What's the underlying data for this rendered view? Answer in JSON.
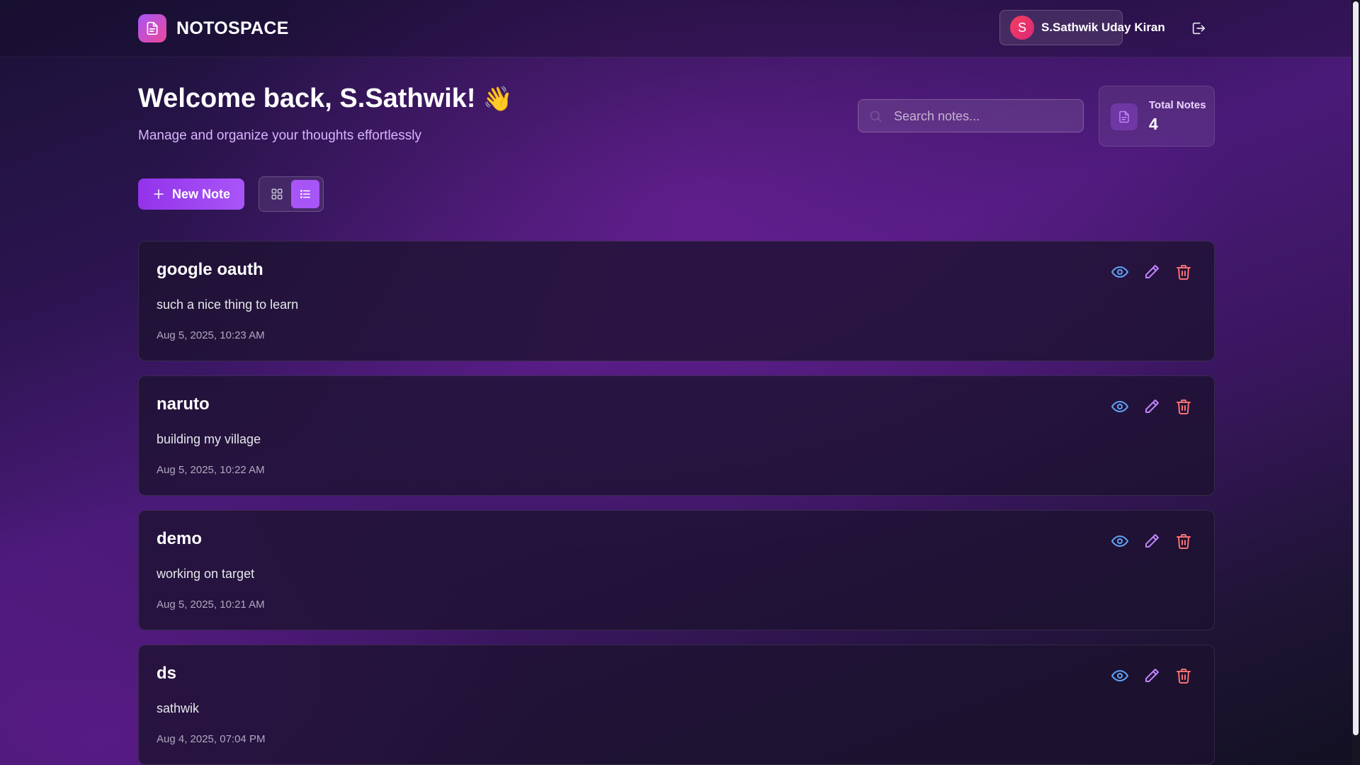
{
  "brand": {
    "name": "NOTOSPACE",
    "icon": "document-icon"
  },
  "user": {
    "initial": "S",
    "name": "S.Sathwik Uday Kiran"
  },
  "header": {
    "logout_icon": "logout-icon"
  },
  "hero": {
    "welcome": "Welcome back, S.Sathwik!",
    "wave_emoji": "👋",
    "subtitle": "Manage and organize your thoughts effortlessly"
  },
  "search": {
    "placeholder": "Search notes...",
    "value": ""
  },
  "stats": {
    "label": "Total Notes",
    "count": "4"
  },
  "toolbar": {
    "new_note_label": "New Note",
    "view_mode": "list",
    "view_options": [
      "grid",
      "list"
    ]
  },
  "notes": [
    {
      "title": "google oauth",
      "body": "such a nice thing to learn",
      "date": "Aug 5, 2025, 10:23 AM"
    },
    {
      "title": "naruto",
      "body": "building my village",
      "date": "Aug 5, 2025, 10:22 AM"
    },
    {
      "title": "demo",
      "body": "working on target",
      "date": "Aug 5, 2025, 10:21 AM"
    },
    {
      "title": "ds",
      "body": "sathwik",
      "date": "Aug 4, 2025, 07:04 PM"
    }
  ],
  "colors": {
    "accent": "#a855f7",
    "view_icon": "#60a5fa",
    "edit_icon": "#c084fc",
    "delete_icon": "#f87171",
    "subtitle": "#d8b4fe"
  }
}
